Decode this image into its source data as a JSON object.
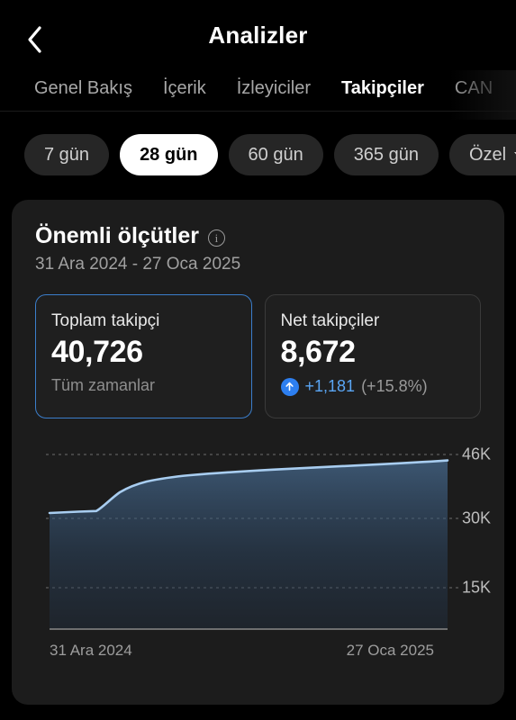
{
  "header": {
    "title": "Analizler",
    "back_icon": "chevron-left-icon"
  },
  "tabs": [
    {
      "label": "Genel Bakış",
      "active": false
    },
    {
      "label": "İçerik",
      "active": false
    },
    {
      "label": "İzleyiciler",
      "active": false
    },
    {
      "label": "Takipçiler",
      "active": true
    },
    {
      "label": "CAN",
      "active": false
    }
  ],
  "date_filters": [
    {
      "label": "7 gün",
      "active": false,
      "caret": false
    },
    {
      "label": "28 gün",
      "active": true,
      "caret": false
    },
    {
      "label": "60 gün",
      "active": false,
      "caret": false
    },
    {
      "label": "365 gün",
      "active": false,
      "caret": false
    },
    {
      "label": "Özel",
      "active": false,
      "caret": true
    }
  ],
  "card": {
    "title": "Önemli ölçütler",
    "info_icon": "info-icon",
    "info_glyph": "i",
    "date_range": "31 Ara 2024 - 27 Oca 2025"
  },
  "metrics": [
    {
      "label": "Toplam takipçi",
      "value": "40,726",
      "sub": "Tüm zamanlar",
      "selected": true
    },
    {
      "label": "Net takipçiler",
      "value": "8,672",
      "delta_icon": "arrow-up-icon",
      "delta_value": "+1,181",
      "delta_pct": "(+15.8%)",
      "selected": false
    }
  ],
  "colors": {
    "accent_blue": "#3b7ecb",
    "line_blue": "#9cc8f0",
    "delta_badge": "#2d7ff0",
    "delta_text": "#5aa6f5",
    "card_bg": "#1c1c1c",
    "page_bg": "#000000"
  },
  "chart_data": {
    "type": "area",
    "title": "",
    "xlabel": "",
    "ylabel": "",
    "x_start_label": "31 Ara 2024",
    "x_end_label": "27 Oca 2025",
    "yticks": [
      {
        "label": "46K",
        "value": 46000
      },
      {
        "label": "30K",
        "value": 30000
      },
      {
        "label": "15K",
        "value": 15000
      }
    ],
    "ylim": [
      0,
      50000
    ],
    "grid": true,
    "legend": "none",
    "series": [
      {
        "name": "Toplam takipçi",
        "x": [
          "31 Ara 2024",
          "1 Oca 2025",
          "2 Oca 2025",
          "3 Oca 2025",
          "4 Oca 2025",
          "5 Oca 2025",
          "6 Oca 2025",
          "7 Oca 2025",
          "8 Oca 2025",
          "9 Oca 2025",
          "10 Oca 2025",
          "11 Oca 2025",
          "12 Oca 2025",
          "13 Oca 2025",
          "14 Oca 2025",
          "15 Oca 2025",
          "16 Oca 2025",
          "17 Oca 2025",
          "18 Oca 2025",
          "19 Oca 2025",
          "20 Oca 2025",
          "21 Oca 2025",
          "22 Oca 2025",
          "23 Oca 2025",
          "24 Oca 2025",
          "25 Oca 2025",
          "26 Oca 2025",
          "27 Oca 2025"
        ],
        "values": [
          32054,
          32100,
          32180,
          32260,
          33100,
          34600,
          35800,
          36500,
          37000,
          37350,
          37620,
          37850,
          38050,
          38200,
          38350,
          38500,
          38650,
          38800,
          38950,
          39100,
          39280,
          39460,
          39640,
          39820,
          40020,
          40250,
          40500,
          40726
        ]
      }
    ]
  }
}
